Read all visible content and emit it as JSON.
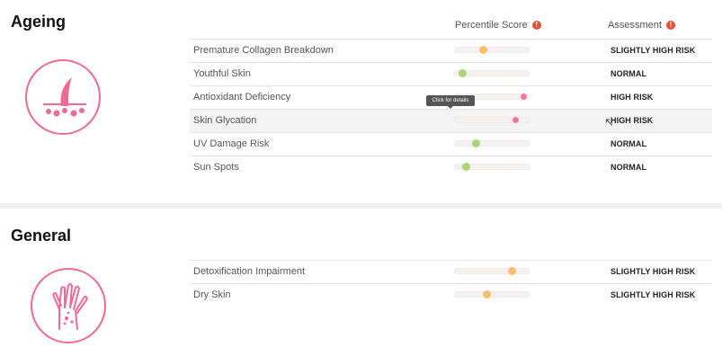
{
  "headers": {
    "percentile": "Percentile Score",
    "assessment": "Assessment",
    "info_icon": "info-circle-icon"
  },
  "colors": {
    "accent": "#f06a98",
    "normal": "#a7d676",
    "slightly_high": "#f7c06d",
    "high": "#f07a94"
  },
  "tooltip": "Click for details",
  "sections": [
    {
      "title": "Ageing",
      "icon": "skin-hair-follicle-icon",
      "rows": [
        {
          "label": "Premature Collagen Breakdown",
          "percentile": 0.38,
          "assessment": "SLIGHTLY HIGH RISK",
          "level": "slightly_high"
        },
        {
          "label": "Youthful Skin",
          "percentile": 0.1,
          "assessment": "NORMAL",
          "level": "normal"
        },
        {
          "label": "Antioxidant Deficiency",
          "percentile": 0.93,
          "assessment": "HIGH RISK",
          "level": "high"
        },
        {
          "label": "Skin Glycation",
          "percentile": 0.82,
          "assessment": "HIGH RISK",
          "level": "high"
        },
        {
          "label": "UV Damage Risk",
          "percentile": 0.28,
          "assessment": "NORMAL",
          "level": "normal"
        },
        {
          "label": "Sun Spots",
          "percentile": 0.15,
          "assessment": "NORMAL",
          "level": "normal"
        }
      ]
    },
    {
      "title": "General",
      "icon": "hand-rash-icon",
      "rows": [
        {
          "label": "Detoxification Impairment",
          "percentile": 0.77,
          "assessment": "SLIGHTLY HIGH RISK",
          "level": "slightly_high"
        },
        {
          "label": "Dry Skin",
          "percentile": 0.43,
          "assessment": "SLIGHTLY HIGH RISK",
          "level": "slightly_high"
        }
      ]
    }
  ]
}
